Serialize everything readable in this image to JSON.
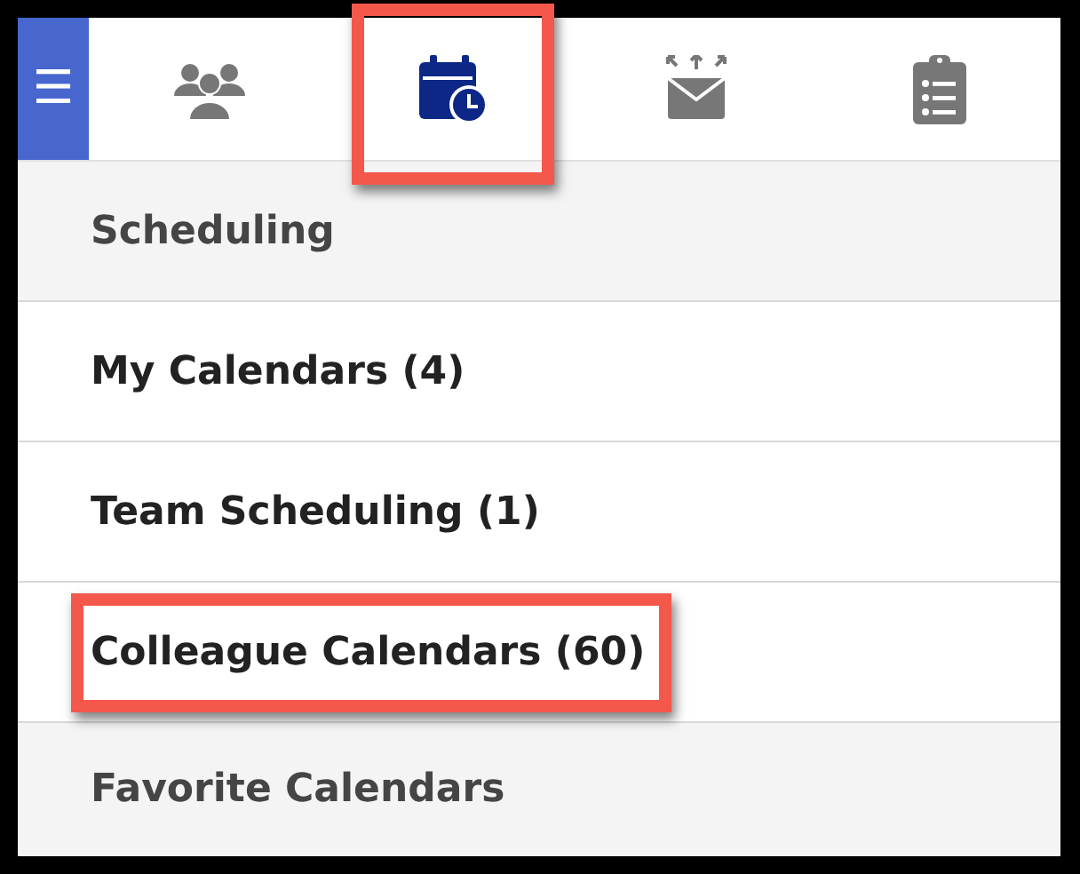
{
  "menu_button": {
    "label": "☰"
  },
  "tabs": [
    {
      "kind": "people",
      "selected": false,
      "highlighted": false
    },
    {
      "kind": "calendar",
      "selected": true,
      "highlighted": true
    },
    {
      "kind": "mail",
      "selected": false,
      "highlighted": false
    },
    {
      "kind": "clipboard",
      "selected": false,
      "highlighted": false
    }
  ],
  "rows": [
    {
      "kind": "header",
      "label": "Scheduling",
      "highlighted": false
    },
    {
      "kind": "item",
      "label": "My Calendars (4)",
      "highlighted": false
    },
    {
      "kind": "item",
      "label": "Team Scheduling (1)",
      "highlighted": false
    },
    {
      "kind": "item",
      "label": "Colleague Calendars (60)",
      "highlighted": true
    },
    {
      "kind": "header",
      "label": "Favorite Calendars",
      "highlighted": false
    }
  ]
}
